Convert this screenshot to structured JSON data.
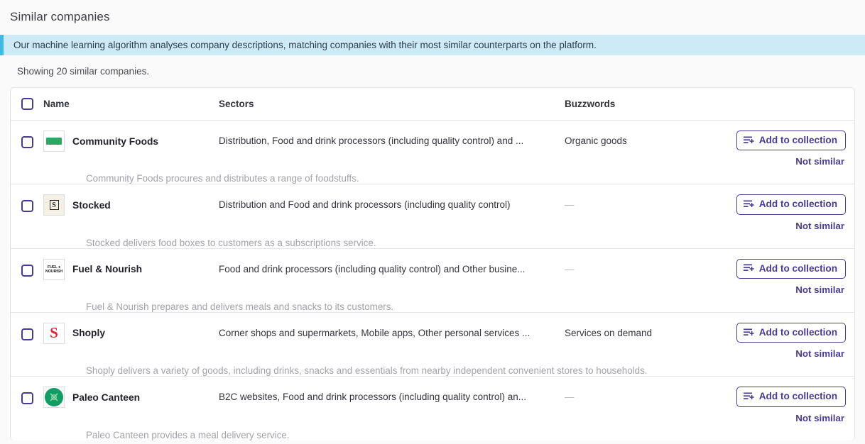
{
  "page": {
    "title": "Similar companies",
    "info_banner": "Our machine learning algorithm analyses company descriptions, matching companies with their most similar counterparts on the platform.",
    "showing": "Showing 20 similar companies.",
    "accent_purple": "#4a3a96",
    "banner_bg": "#cdeaf7",
    "banner_border": "#3fb9e8"
  },
  "table": {
    "headers": {
      "name": "Name",
      "sectors": "Sectors",
      "buzzwords": "Buzzwords"
    },
    "actions": {
      "add_label": "Add to collection",
      "not_similar_label": "Not similar"
    },
    "empty_value": "—",
    "rows": [
      {
        "name": "Community Foods",
        "sectors": "Distribution, Food and drink processors (including quality control) and ...",
        "buzzwords": "Organic goods",
        "description": "Community Foods procures and distributes a range of foodstuffs.",
        "logo": "community-foods-logo"
      },
      {
        "name": "Stocked",
        "sectors": "Distribution and Food and drink processors (including quality control)",
        "buzzwords": "—",
        "description": "Stocked delivers food boxes to customers as a subscriptions service.",
        "logo": "stocked-logo"
      },
      {
        "name": "Fuel & Nourish",
        "sectors": "Food and drink processors (including quality control) and Other busine...",
        "buzzwords": "—",
        "description": "Fuel & Nourish prepares and delivers meals and snacks to its customers.",
        "logo": "fuel-and-nourish-logo"
      },
      {
        "name": "Shoply",
        "sectors": "Corner shops and supermarkets, Mobile apps, Other personal services ...",
        "buzzwords": "Services on demand",
        "description": "Shoply delivers a variety of goods, including drinks, snacks and essentials from nearby independent convenient stores to households.",
        "logo": "shoply-logo"
      },
      {
        "name": "Paleo Canteen",
        "sectors": "B2C websites, Food and drink processors (including quality control) an...",
        "buzzwords": "—",
        "description": "Paleo Canteen provides a meal delivery service.",
        "logo": "paleo-canteen-logo"
      }
    ]
  }
}
